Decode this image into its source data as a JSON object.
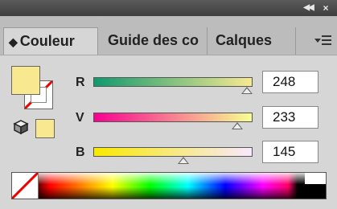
{
  "panel": {
    "title_buttons": {
      "collapse": "◀◀",
      "close": "×"
    },
    "tabs": [
      {
        "label": "Couleur",
        "active": true,
        "close_glyph": "◆"
      },
      {
        "label": "Guide des co",
        "active": false
      },
      {
        "label": "Calques",
        "active": false
      }
    ]
  },
  "color": {
    "fill_hex": "#F8E991",
    "stroke": "none",
    "sliders": [
      {
        "label": "R",
        "value": "248",
        "level": 0.973,
        "gradient": [
          "#0f9a6e",
          "#f8e991"
        ]
      },
      {
        "label": "V",
        "value": "233",
        "level": 0.914,
        "gradient": [
          "#f80091",
          "#f8ff91"
        ]
      },
      {
        "label": "B",
        "value": "145",
        "level": 0.569,
        "gradient": [
          "#f8e900",
          "#f8e9ff"
        ]
      }
    ]
  },
  "icons": {
    "gamut": "cube-icon",
    "none": "none-swatch-icon",
    "menu": "panel-menu-icon"
  }
}
